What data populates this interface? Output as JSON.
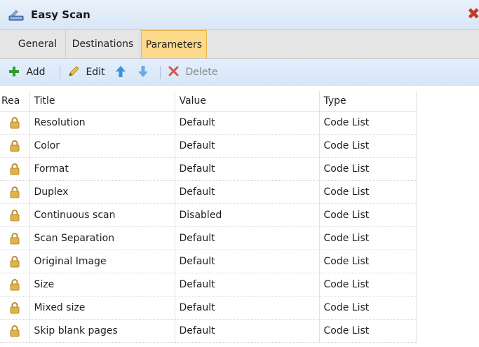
{
  "window": {
    "title": "Easy Scan",
    "close_icon": "close-icon"
  },
  "tabs": [
    {
      "label": "General",
      "active": false
    },
    {
      "label": "Destinations",
      "active": false
    },
    {
      "label": "Parameters",
      "active": true
    }
  ],
  "toolbar": {
    "add_label": "Add",
    "edit_label": "Edit",
    "delete_label": "Delete"
  },
  "table": {
    "headers": [
      "Rea",
      "Title",
      "Value",
      "Type"
    ],
    "rows": [
      {
        "title": "Resolution",
        "value": "Default",
        "type": "Code List"
      },
      {
        "title": "Color",
        "value": "Default",
        "type": "Code List"
      },
      {
        "title": "Format",
        "value": "Default",
        "type": "Code List"
      },
      {
        "title": "Duplex",
        "value": "Default",
        "type": "Code List"
      },
      {
        "title": "Continuous scan",
        "value": "Disabled",
        "type": "Code List"
      },
      {
        "title": "Scan Separation",
        "value": "Default",
        "type": "Code List"
      },
      {
        "title": "Original Image",
        "value": "Default",
        "type": "Code List"
      },
      {
        "title": "Size",
        "value": "Default",
        "type": "Code List"
      },
      {
        "title": "Mixed size",
        "value": "Default",
        "type": "Code List"
      },
      {
        "title": "Skip blank pages",
        "value": "Default",
        "type": "Code List"
      }
    ]
  },
  "colors": {
    "active_tab": "#fdd98a",
    "add_icon": "#2e9b2e",
    "arrow_icons": "#3d8fe0",
    "delete_icon": "#d9534f",
    "lock_icon": "#e0b24a"
  }
}
